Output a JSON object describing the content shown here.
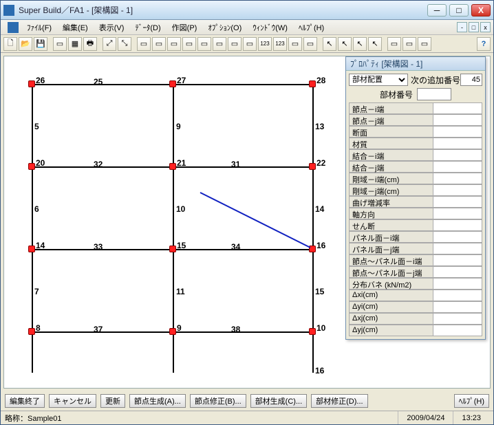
{
  "title": "Super Build／FA1 - [架構図 - 1]",
  "menus": {
    "file": "ﾌｧｲﾙ(F)",
    "edit": "編集(E)",
    "view": "表示(V)",
    "data": "ﾃﾞｰﾀ(D)",
    "draw": "作図(P)",
    "opt": "ｵﾌﾟｼｮﾝ(O)",
    "window": "ｳｨﾝﾄﾞｳ(W)",
    "help": "ﾍﾙﾌﾟ(H)"
  },
  "prop": {
    "header": "ﾌﾟﾛﾊﾟﾃｨ [架構図 - 1]",
    "mode": "部材配置",
    "next_label": "次の追加番号",
    "next_val": "45",
    "memno_label": "部材番号",
    "memno_val": "",
    "fields": [
      {
        "k": "f0",
        "label": "節点－i端",
        "val": ""
      },
      {
        "k": "f1",
        "label": "節点－j端",
        "val": ""
      },
      {
        "k": "f2",
        "label": "断面",
        "val": ""
      },
      {
        "k": "f3",
        "label": "材質",
        "val": ""
      },
      {
        "k": "f4",
        "label": "結合－i端",
        "val": ""
      },
      {
        "k": "f5",
        "label": "結合－j端",
        "val": ""
      },
      {
        "k": "f6",
        "label": "剛域－i端(cm)",
        "val": ""
      },
      {
        "k": "f7",
        "label": "剛域－j端(cm)",
        "val": ""
      },
      {
        "k": "f8",
        "label": "曲げ増減率",
        "val": ""
      },
      {
        "k": "f9",
        "label": "軸方向",
        "val": ""
      },
      {
        "k": "f10",
        "label": "せん断",
        "val": ""
      },
      {
        "k": "f11",
        "label": "パネル面－i端",
        "val": ""
      },
      {
        "k": "f12",
        "label": "パネル面－j端",
        "val": ""
      },
      {
        "k": "f13",
        "label": "節点～パネル面－i端",
        "val": ""
      },
      {
        "k": "f14",
        "label": "節点～パネル面－j端",
        "val": ""
      },
      {
        "k": "f15",
        "label": "分布バネ (kN/m2)",
        "val": ""
      },
      {
        "k": "f16",
        "label": "Δxi(cm)",
        "val": ""
      },
      {
        "k": "f17",
        "label": "Δyi(cm)",
        "val": ""
      },
      {
        "k": "f18",
        "label": "Δxj(cm)",
        "val": ""
      },
      {
        "k": "f19",
        "label": "Δyj(cm)",
        "val": ""
      }
    ]
  },
  "buttons": {
    "endedit": "編集終了",
    "cancel": "キャンセル",
    "update": "更新",
    "gennode": "節点生成(A)...",
    "fixnode": "節点修正(B)...",
    "genmemb": "部材生成(C)...",
    "fixmemb": "部材修正(D)...",
    "help": "ﾍﾙﾌﾟ(H)"
  },
  "status": {
    "name": "略称：Sample01",
    "date": "2009/04/24",
    "time": "13:23"
  },
  "labels": {
    "n26": "26",
    "n27": "27",
    "n28": "28",
    "n20": "20",
    "n21": "21",
    "n22": "22",
    "n14": "14",
    "n15": "15",
    "n16": "16",
    "n8": "8",
    "n9": "9",
    "n10r": "10",
    "m25": "25",
    "m5": "5",
    "m9": "9",
    "m13": "13",
    "m32": "32",
    "m31": "31",
    "m6": "6",
    "m10": "10",
    "m14r": "14",
    "m33": "33",
    "m34": "34",
    "m7": "7",
    "m11": "11",
    "m15": "15",
    "m37": "37",
    "m38": "38",
    "m16": "16"
  }
}
